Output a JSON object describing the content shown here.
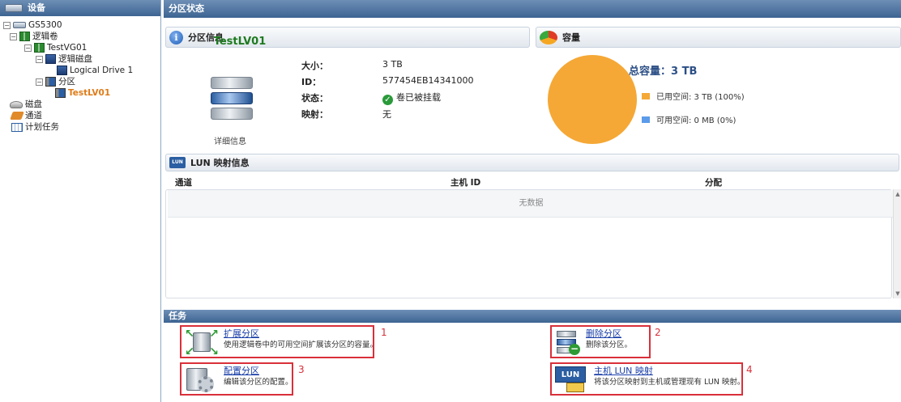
{
  "left_panel": {
    "title": "设备",
    "tree": [
      {
        "label": "GS5300",
        "expander": "−",
        "icon": "storage-device-icon"
      },
      {
        "label": "逻辑卷",
        "expander": "−",
        "icon": "logical-volume-icon"
      },
      {
        "label": "TestVG01",
        "expander": "−",
        "icon": "volume-group-icon"
      },
      {
        "label": "逻辑磁盘",
        "expander": "−",
        "icon": "logical-disk-icon"
      },
      {
        "label": "Logical Drive 1",
        "icon": "logical-drive-icon"
      },
      {
        "label": "分区",
        "expander": "−",
        "icon": "partition-icon"
      },
      {
        "label": "TestLV01",
        "icon": "partition-item-icon",
        "selected": true
      },
      {
        "label": "磁盘",
        "icon": "disk-icon"
      },
      {
        "label": "通道",
        "icon": "channel-icon"
      },
      {
        "label": "计划任务",
        "icon": "scheduled-task-icon"
      }
    ]
  },
  "main": {
    "title": "分区状态",
    "partition_info": {
      "section_title": "分区信息",
      "name": "TestLV01",
      "detail_link": "详细信息",
      "fields": [
        {
          "key": "大小：",
          "value": "3 TB"
        },
        {
          "key": "ID：",
          "value": "577454EB14341000"
        },
        {
          "key": "状态：",
          "value": "卷已被挂载"
        },
        {
          "key": "映射：",
          "value": "无"
        }
      ]
    },
    "capacity": {
      "section_title": "容量",
      "total_label": "总容量：3 TB",
      "legend": [
        {
          "label": "已用空间: 3 TB (100%)",
          "color": "#f5a836"
        },
        {
          "label": "可用空间: 0 MB (0%)",
          "color": "#5b9bea"
        }
      ],
      "used_fraction": 1.0
    },
    "lun": {
      "section_title": "LUN 映射信息",
      "icon_text": "LUN",
      "columns": [
        "通道",
        "主机 ID",
        "分配"
      ],
      "empty_text": "无数据"
    },
    "tasks": {
      "title": "任务",
      "items": [
        {
          "num": "1",
          "title": "扩展分区",
          "desc": "使用逻辑卷中的可用空间扩展该分区的容量。",
          "icon": "expand-partition-icon"
        },
        {
          "num": "2",
          "title": "删除分区",
          "desc": "删除该分区。",
          "icon": "delete-partition-icon"
        },
        {
          "num": "3",
          "title": "配置分区",
          "desc": "编辑该分区的配置。",
          "icon": "configure-partition-icon"
        },
        {
          "num": "4",
          "title": "主机 LUN 映射",
          "desc": "将该分区映射到主机或管理现有 LUN 映射。",
          "icon": "host-lun-mapping-icon",
          "icon_text": "LUN"
        }
      ]
    }
  }
}
